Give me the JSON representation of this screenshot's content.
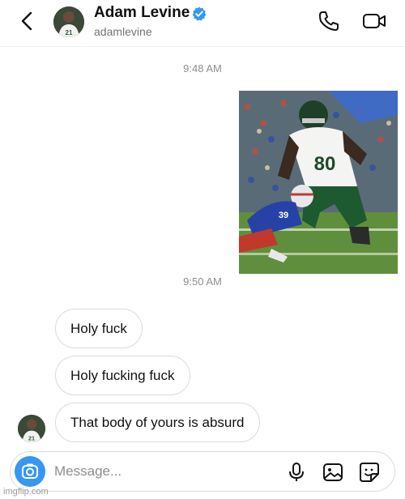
{
  "header": {
    "name": "Adam Levine",
    "username": "adamlevine",
    "verified": true,
    "avatar_jersey_number": "21"
  },
  "timestamps": [
    "9:48 AM",
    "9:50 AM"
  ],
  "sent_photo": {
    "description_icon": "football-photo",
    "jersey_number_large": "80",
    "jersey_number_small": "39"
  },
  "messages": [
    {
      "text": "Holy fuck"
    },
    {
      "text": "Holy fucking fuck"
    },
    {
      "text": "That body of yours is absurd"
    }
  ],
  "composer": {
    "placeholder": "Message..."
  },
  "watermark": "imgflip.com",
  "colors": {
    "accent": "#3797f0",
    "verified": "#3897f0",
    "timestamp": "#8e8e8e",
    "bubble_border": "#dbdbdb"
  }
}
